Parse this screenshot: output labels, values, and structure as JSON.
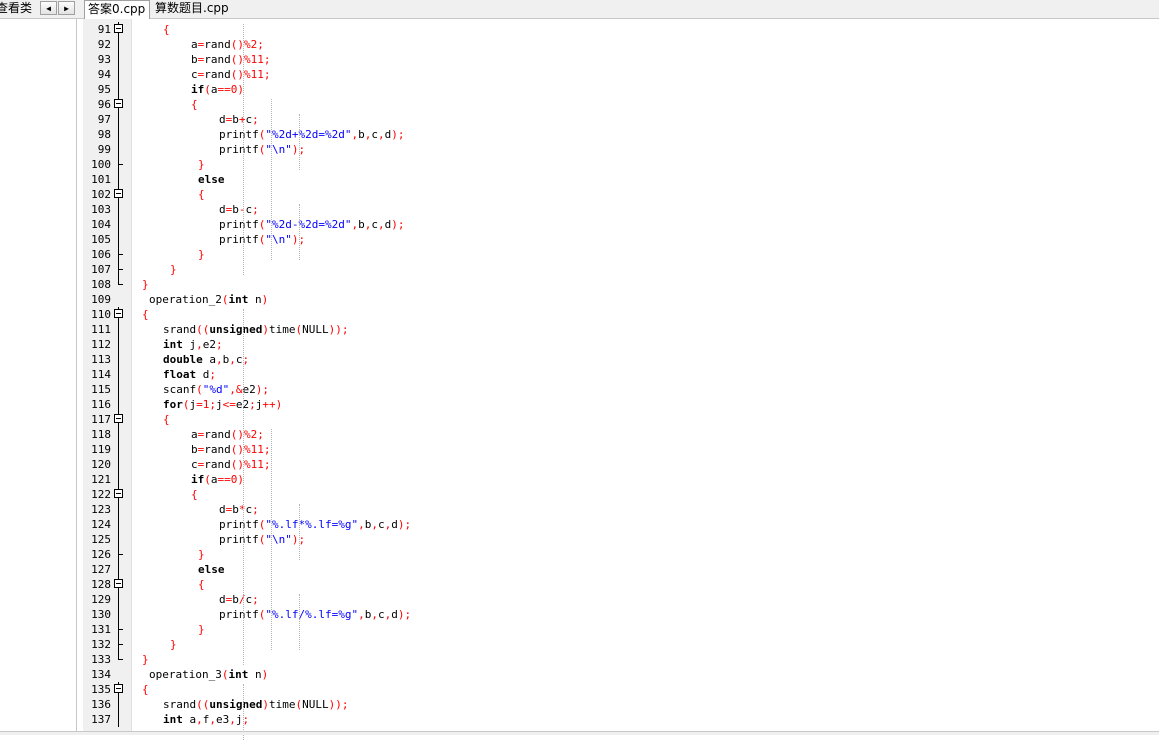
{
  "panel": {
    "title": "查看类"
  },
  "tabs": [
    {
      "label": "答案0.cpp",
      "active": true
    },
    {
      "label": "算数题目.cpp",
      "active": false
    }
  ],
  "colors": {
    "keyword": "#000000",
    "operator": "#ff0000",
    "string": "#0000ff",
    "gutter": "#f0f0f0"
  },
  "editor": {
    "lines": [
      {
        "n": "91",
        "fold": "open",
        "segs": [
          [
            "op",
            "{"
          ]
        ]
      },
      {
        "n": "92",
        "fold": "line",
        "segs": [
          [
            "t",
            "a"
          ],
          [
            "op",
            "="
          ],
          [
            "t",
            "rand"
          ],
          [
            "op",
            "()%"
          ],
          [
            "num",
            "2"
          ],
          [
            "op",
            ";"
          ]
        ]
      },
      {
        "n": "93",
        "fold": "line",
        "segs": [
          [
            "t",
            "b"
          ],
          [
            "op",
            "="
          ],
          [
            "t",
            "rand"
          ],
          [
            "op",
            "()%"
          ],
          [
            "num",
            "11"
          ],
          [
            "op",
            ";"
          ]
        ]
      },
      {
        "n": "94",
        "fold": "line",
        "segs": [
          [
            "t",
            "c"
          ],
          [
            "op",
            "="
          ],
          [
            "t",
            "rand"
          ],
          [
            "op",
            "()%"
          ],
          [
            "num",
            "11"
          ],
          [
            "op",
            ";"
          ]
        ]
      },
      {
        "n": "95",
        "fold": "line",
        "segs": [
          [
            "kw",
            "if"
          ],
          [
            "op",
            "("
          ],
          [
            "t",
            "a"
          ],
          [
            "op",
            "=="
          ],
          [
            "num",
            "0"
          ],
          [
            "op",
            ")"
          ]
        ]
      },
      {
        "n": "96",
        "fold": "open",
        "segs": [
          [
            "op",
            "{"
          ]
        ]
      },
      {
        "n": "97",
        "fold": "line",
        "segs": [
          [
            "t",
            "d"
          ],
          [
            "op",
            "="
          ],
          [
            "t",
            "b"
          ],
          [
            "op",
            "+"
          ],
          [
            "t",
            "c"
          ],
          [
            "op",
            ";"
          ]
        ]
      },
      {
        "n": "98",
        "fold": "line",
        "segs": [
          [
            "t",
            "printf"
          ],
          [
            "op",
            "("
          ],
          [
            "str",
            "\"%2d+%2d=%2d\""
          ],
          [
            "op",
            ","
          ],
          [
            "t",
            "b"
          ],
          [
            "op",
            ","
          ],
          [
            "t",
            "c"
          ],
          [
            "op",
            ","
          ],
          [
            "t",
            "d"
          ],
          [
            "op",
            ");"
          ]
        ]
      },
      {
        "n": "99",
        "fold": "line",
        "segs": [
          [
            "t",
            "printf"
          ],
          [
            "op",
            "("
          ],
          [
            "str",
            "\"\\n\""
          ],
          [
            "op",
            ");"
          ]
        ]
      },
      {
        "n": "100",
        "fold": "end",
        "segs": [
          [
            "op",
            "}"
          ]
        ]
      },
      {
        "n": "101",
        "fold": "line",
        "segs": [
          [
            "kw",
            "else"
          ]
        ]
      },
      {
        "n": "102",
        "fold": "open",
        "segs": [
          [
            "op",
            "{"
          ]
        ]
      },
      {
        "n": "103",
        "fold": "line",
        "segs": [
          [
            "t",
            "d"
          ],
          [
            "op",
            "="
          ],
          [
            "t",
            "b"
          ],
          [
            "op",
            "-"
          ],
          [
            "t",
            "c"
          ],
          [
            "op",
            ";"
          ]
        ]
      },
      {
        "n": "104",
        "fold": "line",
        "segs": [
          [
            "t",
            "printf"
          ],
          [
            "op",
            "("
          ],
          [
            "str",
            "\"%2d-%2d=%2d\""
          ],
          [
            "op",
            ","
          ],
          [
            "t",
            "b"
          ],
          [
            "op",
            ","
          ],
          [
            "t",
            "c"
          ],
          [
            "op",
            ","
          ],
          [
            "t",
            "d"
          ],
          [
            "op",
            ");"
          ]
        ]
      },
      {
        "n": "105",
        "fold": "line",
        "segs": [
          [
            "t",
            "printf"
          ],
          [
            "op",
            "("
          ],
          [
            "str",
            "\"\\n\""
          ],
          [
            "op",
            ");"
          ]
        ]
      },
      {
        "n": "106",
        "fold": "end",
        "segs": [
          [
            "op",
            "}"
          ]
        ]
      },
      {
        "n": "107",
        "fold": "end",
        "segs": [
          [
            "op",
            "}"
          ]
        ]
      },
      {
        "n": "108",
        "fold": "endlast",
        "segs": [
          [
            "op",
            "}"
          ]
        ]
      },
      {
        "n": "109",
        "fold": "none",
        "segs": [
          [
            "t",
            "operation_2"
          ],
          [
            "op",
            "("
          ],
          [
            "kw",
            "int"
          ],
          [
            "t",
            " n"
          ],
          [
            "op",
            ")"
          ]
        ]
      },
      {
        "n": "110",
        "fold": "open",
        "segs": [
          [
            "op",
            "{"
          ]
        ]
      },
      {
        "n": "111",
        "fold": "line",
        "segs": [
          [
            "t",
            "srand"
          ],
          [
            "op",
            "(("
          ],
          [
            "kw",
            "unsigned"
          ],
          [
            "op",
            ")"
          ],
          [
            "t",
            "time"
          ],
          [
            "op",
            "("
          ],
          [
            "t",
            "NULL"
          ],
          [
            "op",
            "));"
          ]
        ]
      },
      {
        "n": "112",
        "fold": "line",
        "segs": [
          [
            "kw",
            "int"
          ],
          [
            "t",
            " j"
          ],
          [
            "op",
            ","
          ],
          [
            "t",
            "e2"
          ],
          [
            "op",
            ";"
          ]
        ]
      },
      {
        "n": "113",
        "fold": "line",
        "segs": [
          [
            "kw",
            "double"
          ],
          [
            "t",
            " a"
          ],
          [
            "op",
            ","
          ],
          [
            "t",
            "b"
          ],
          [
            "op",
            ","
          ],
          [
            "t",
            "c"
          ],
          [
            "op",
            ";"
          ]
        ]
      },
      {
        "n": "114",
        "fold": "line",
        "segs": [
          [
            "kw",
            "float"
          ],
          [
            "t",
            " d"
          ],
          [
            "op",
            ";"
          ]
        ]
      },
      {
        "n": "115",
        "fold": "line",
        "segs": [
          [
            "t",
            "scanf"
          ],
          [
            "op",
            "("
          ],
          [
            "str",
            "\"%d\""
          ],
          [
            "op",
            ",&"
          ],
          [
            "t",
            "e2"
          ],
          [
            "op",
            ");"
          ]
        ]
      },
      {
        "n": "116",
        "fold": "line",
        "segs": [
          [
            "kw",
            "for"
          ],
          [
            "op",
            "("
          ],
          [
            "t",
            "j"
          ],
          [
            "op",
            "="
          ],
          [
            "num",
            "1"
          ],
          [
            "op",
            ";"
          ],
          [
            "t",
            "j"
          ],
          [
            "op",
            "<="
          ],
          [
            "t",
            "e2"
          ],
          [
            "op",
            ";"
          ],
          [
            "t",
            "j"
          ],
          [
            "op",
            "++)"
          ]
        ]
      },
      {
        "n": "117",
        "fold": "open",
        "segs": [
          [
            "op",
            "{"
          ]
        ]
      },
      {
        "n": "118",
        "fold": "line",
        "segs": [
          [
            "t",
            "a"
          ],
          [
            "op",
            "="
          ],
          [
            "t",
            "rand"
          ],
          [
            "op",
            "()%"
          ],
          [
            "num",
            "2"
          ],
          [
            "op",
            ";"
          ]
        ]
      },
      {
        "n": "119",
        "fold": "line",
        "segs": [
          [
            "t",
            "b"
          ],
          [
            "op",
            "="
          ],
          [
            "t",
            "rand"
          ],
          [
            "op",
            "()%"
          ],
          [
            "num",
            "11"
          ],
          [
            "op",
            ";"
          ]
        ]
      },
      {
        "n": "120",
        "fold": "line",
        "segs": [
          [
            "t",
            "c"
          ],
          [
            "op",
            "="
          ],
          [
            "t",
            "rand"
          ],
          [
            "op",
            "()%"
          ],
          [
            "num",
            "11"
          ],
          [
            "op",
            ";"
          ]
        ]
      },
      {
        "n": "121",
        "fold": "line",
        "segs": [
          [
            "kw",
            "if"
          ],
          [
            "op",
            "("
          ],
          [
            "t",
            "a"
          ],
          [
            "op",
            "=="
          ],
          [
            "num",
            "0"
          ],
          [
            "op",
            ")"
          ]
        ]
      },
      {
        "n": "122",
        "fold": "open",
        "segs": [
          [
            "op",
            "{"
          ]
        ]
      },
      {
        "n": "123",
        "fold": "line",
        "segs": [
          [
            "t",
            "d"
          ],
          [
            "op",
            "="
          ],
          [
            "t",
            "b"
          ],
          [
            "op",
            "*"
          ],
          [
            "t",
            "c"
          ],
          [
            "op",
            ";"
          ]
        ]
      },
      {
        "n": "124",
        "fold": "line",
        "segs": [
          [
            "t",
            "printf"
          ],
          [
            "op",
            "("
          ],
          [
            "str",
            "\"%.lf*%.lf=%g\""
          ],
          [
            "op",
            ","
          ],
          [
            "t",
            "b"
          ],
          [
            "op",
            ","
          ],
          [
            "t",
            "c"
          ],
          [
            "op",
            ","
          ],
          [
            "t",
            "d"
          ],
          [
            "op",
            ");"
          ]
        ]
      },
      {
        "n": "125",
        "fold": "line",
        "segs": [
          [
            "t",
            "printf"
          ],
          [
            "op",
            "("
          ],
          [
            "str",
            "\"\\n\""
          ],
          [
            "op",
            ");"
          ]
        ]
      },
      {
        "n": "126",
        "fold": "end",
        "segs": [
          [
            "op",
            "}"
          ]
        ]
      },
      {
        "n": "127",
        "fold": "line",
        "segs": [
          [
            "kw",
            "else"
          ]
        ]
      },
      {
        "n": "128",
        "fold": "open",
        "segs": [
          [
            "op",
            "{"
          ]
        ]
      },
      {
        "n": "129",
        "fold": "line",
        "segs": [
          [
            "t",
            "d"
          ],
          [
            "op",
            "="
          ],
          [
            "t",
            "b"
          ],
          [
            "op",
            "/"
          ],
          [
            "t",
            "c"
          ],
          [
            "op",
            ";"
          ]
        ]
      },
      {
        "n": "130",
        "fold": "line",
        "segs": [
          [
            "t",
            "printf"
          ],
          [
            "op",
            "("
          ],
          [
            "str",
            "\"%.lf/%.lf=%g\""
          ],
          [
            "op",
            ","
          ],
          [
            "t",
            "b"
          ],
          [
            "op",
            ","
          ],
          [
            "t",
            "c"
          ],
          [
            "op",
            ","
          ],
          [
            "t",
            "d"
          ],
          [
            "op",
            ");"
          ]
        ]
      },
      {
        "n": "131",
        "fold": "end",
        "segs": [
          [
            "op",
            "}"
          ]
        ]
      },
      {
        "n": "132",
        "fold": "end",
        "segs": [
          [
            "op",
            "}"
          ]
        ]
      },
      {
        "n": "133",
        "fold": "endlast",
        "segs": [
          [
            "op",
            "}"
          ]
        ]
      },
      {
        "n": "134",
        "fold": "none",
        "segs": [
          [
            "t",
            "operation_3"
          ],
          [
            "op",
            "("
          ],
          [
            "kw",
            "int"
          ],
          [
            "t",
            " n"
          ],
          [
            "op",
            ")"
          ]
        ]
      },
      {
        "n": "135",
        "fold": "open",
        "segs": [
          [
            "op",
            "{"
          ]
        ]
      },
      {
        "n": "136",
        "fold": "line",
        "segs": [
          [
            "t",
            "srand"
          ],
          [
            "op",
            "(("
          ],
          [
            "kw",
            "unsigned"
          ],
          [
            "op",
            ")"
          ],
          [
            "t",
            "time"
          ],
          [
            "op",
            "("
          ],
          [
            "t",
            "NULL"
          ],
          [
            "op",
            "));"
          ]
        ]
      },
      {
        "n": "137",
        "fold": "line",
        "segs": [
          [
            "kw",
            "int"
          ],
          [
            "t",
            " a"
          ],
          [
            "op",
            ","
          ],
          [
            "t",
            "f"
          ],
          [
            "op",
            ","
          ],
          [
            "t",
            "e3"
          ],
          [
            "op",
            ","
          ],
          [
            "t",
            "j"
          ],
          [
            "op",
            ";"
          ]
        ]
      }
    ]
  }
}
